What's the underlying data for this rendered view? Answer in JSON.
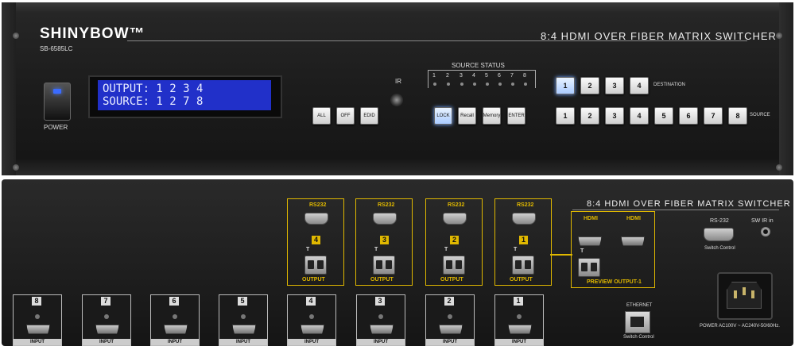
{
  "front": {
    "brand": "SHINYBOW™",
    "model": "SB-6585LC",
    "title": "8:4 HDMI OVER FIBER MATRIX SWITCHER",
    "power_label": "POWER",
    "lcd": {
      "line1": "OUTPUT: 1 2 3 4",
      "line2": "SOURCE: 1 2 7 8"
    },
    "ir_label": "IR",
    "function_buttons": [
      "ALL",
      "OFF",
      "EDID"
    ],
    "control_buttons": [
      "LOCK",
      "Recall",
      "Memory",
      "ENTER"
    ],
    "source_status": {
      "label": "SOURCE STATUS",
      "numbers": [
        "1",
        "2",
        "3",
        "4",
        "5",
        "6",
        "7",
        "8"
      ]
    },
    "destination": {
      "label": "DESTINATION",
      "buttons": [
        "1",
        "2",
        "3",
        "4"
      ],
      "selected": "1"
    },
    "source": {
      "label": "SOURCE",
      "buttons": [
        "1",
        "2",
        "3",
        "4",
        "5",
        "6",
        "7",
        "8"
      ]
    }
  },
  "rear": {
    "title": "8:4 HDMI OVER FIBER MATRIX SWITCHER",
    "outputs": [
      {
        "num": "4",
        "rs232": "RS232",
        "tx": "T",
        "label": "OUTPUT"
      },
      {
        "num": "3",
        "rs232": "RS232",
        "tx": "T",
        "label": "OUTPUT"
      },
      {
        "num": "2",
        "rs232": "RS232",
        "tx": "T",
        "label": "OUTPUT"
      },
      {
        "num": "1",
        "rs232": "RS232",
        "tx": "T",
        "label": "OUTPUT"
      }
    ],
    "preview": {
      "hdmi1": "HDMI",
      "hdmi2": "HDMI",
      "tx": "T",
      "label": "PREVIEW  OUTPUT-1"
    },
    "rs232_label": "RS-232",
    "switch_control": "Switch Control",
    "sw_ir": "SW IR in",
    "ethernet_label": "ETHERNET",
    "ethernet_sub": "Switch Control",
    "power_label": "POWER AC100V ~ AC240V-50/60Hz.",
    "inputs": [
      {
        "num": "8",
        "label": "INPUT"
      },
      {
        "num": "7",
        "label": "INPUT"
      },
      {
        "num": "6",
        "label": "INPUT"
      },
      {
        "num": "5",
        "label": "INPUT"
      },
      {
        "num": "4",
        "label": "INPUT"
      },
      {
        "num": "3",
        "label": "INPUT"
      },
      {
        "num": "2",
        "label": "INPUT"
      },
      {
        "num": "1",
        "label": "INPUT"
      }
    ]
  }
}
